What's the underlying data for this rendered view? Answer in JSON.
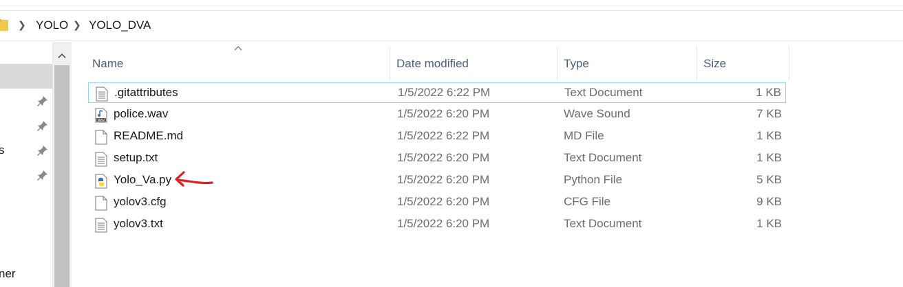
{
  "breadcrumb": {
    "items": [
      "YOLO",
      "YOLO_DVA"
    ]
  },
  "nav": {
    "partial_labels": [
      "s",
      "ner"
    ]
  },
  "columns": {
    "name": "Name",
    "date": "Date modified",
    "type": "Type",
    "size": "Size"
  },
  "files": [
    {
      "name": ".gitattributes",
      "date": "1/5/2022 6:22 PM",
      "type": "Text Document",
      "size": "1 KB",
      "icon": "text-file-icon"
    },
    {
      "name": "police.wav",
      "date": "1/5/2022 6:20 PM",
      "type": "Wave Sound",
      "size": "7 KB",
      "icon": "wav-file-icon"
    },
    {
      "name": "README.md",
      "date": "1/5/2022 6:22 PM",
      "type": "MD File",
      "size": "1 KB",
      "icon": "blank-file-icon"
    },
    {
      "name": "setup.txt",
      "date": "1/5/2022 6:20 PM",
      "type": "Text Document",
      "size": "1 KB",
      "icon": "text-file-icon"
    },
    {
      "name": "Yolo_Va.py",
      "date": "1/5/2022 6:20 PM",
      "type": "Python File",
      "size": "5 KB",
      "icon": "python-file-icon"
    },
    {
      "name": "yolov3.cfg",
      "date": "1/5/2022 6:20 PM",
      "type": "CFG File",
      "size": "9 KB",
      "icon": "blank-file-icon"
    },
    {
      "name": "yolov3.txt",
      "date": "1/5/2022 6:20 PM",
      "type": "Text Document",
      "size": "1 KB",
      "icon": "text-file-icon"
    }
  ],
  "colors": {
    "header_text": "#4c607a",
    "focus_border": "#99d1ff",
    "annotation": "#e02020",
    "nav_selected": "#d9d9d9"
  }
}
